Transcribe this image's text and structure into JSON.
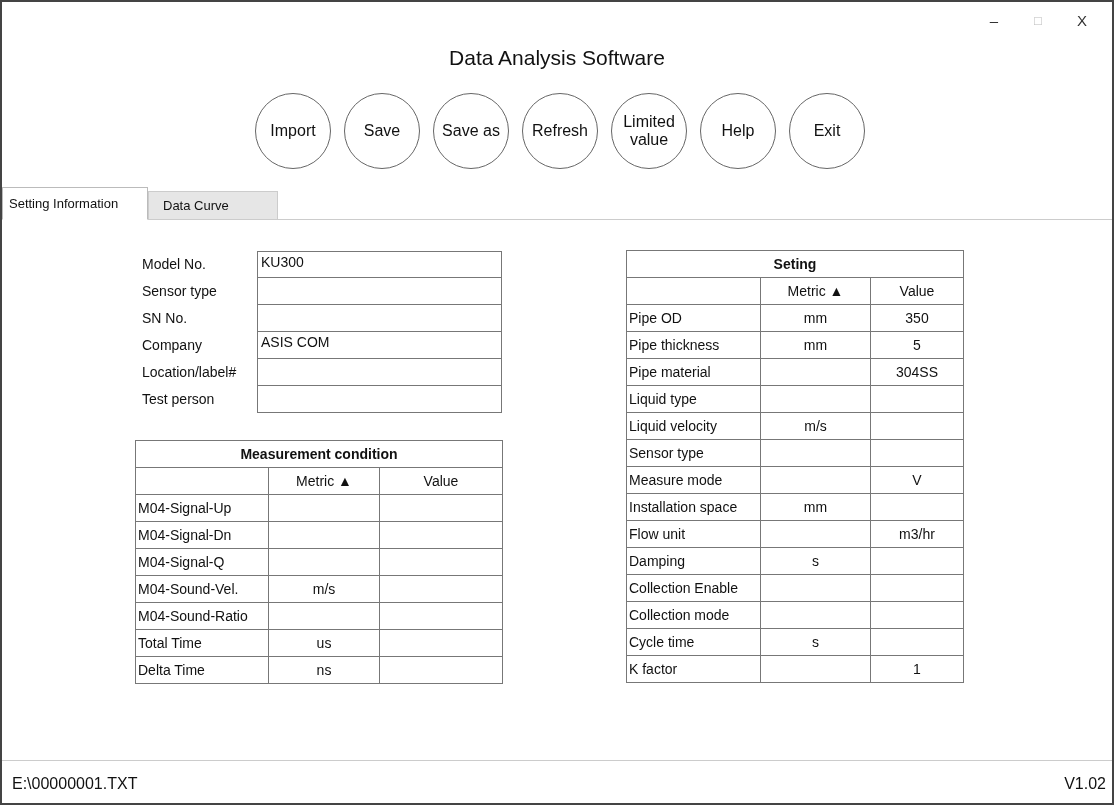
{
  "window": {
    "title": "Data Analysis Software",
    "controls": [
      {
        "kind": "minimize",
        "glyph": "–"
      },
      {
        "kind": "maximize",
        "glyph": "□"
      },
      {
        "kind": "close",
        "glyph": "X"
      }
    ]
  },
  "toolbar": [
    "Import",
    "Save",
    "Save as",
    "Refresh",
    "Limited value",
    "Help",
    "Exit"
  ],
  "tabs": [
    {
      "label": "Setting Information",
      "selected": true
    },
    {
      "label": "Data Curve",
      "selected": false
    }
  ],
  "info_form": [
    {
      "label": "Model No.",
      "value": "KU300"
    },
    {
      "label": "Sensor type"
    },
    {
      "label": "SN No."
    },
    {
      "label": "Company",
      "value": "ASIS COM"
    },
    {
      "label": "Location/label#"
    },
    {
      "label": "Test person"
    }
  ],
  "measurement_table": {
    "title": "Measurement condition",
    "columns": [
      "",
      "Metric ▲",
      "Value"
    ],
    "rows": [
      [
        "M04-Signal-Up",
        "",
        ""
      ],
      [
        "M04-Signal-Dn",
        "",
        ""
      ],
      [
        "M04-Signal-Q",
        "",
        ""
      ],
      [
        "M04-Sound-Vel.",
        "m/s",
        ""
      ],
      [
        "M04-Sound-Ratio",
        "",
        ""
      ],
      [
        "Total Time",
        "us",
        ""
      ],
      [
        "Delta Time",
        "ns",
        ""
      ]
    ]
  },
  "setting_table": {
    "title": "Seting",
    "columns": [
      "",
      "Metric ▲",
      "Value"
    ],
    "rows": [
      [
        "Pipe OD",
        "mm",
        "350"
      ],
      [
        "Pipe thickness",
        "mm",
        "5"
      ],
      [
        "Pipe material",
        "",
        "304SS"
      ],
      [
        "Liquid type",
        "",
        ""
      ],
      [
        "Liquid velocity",
        "m/s",
        ""
      ],
      [
        "Sensor type",
        "",
        ""
      ],
      [
        "Measure mode",
        "",
        "V"
      ],
      [
        "Installation space",
        "mm",
        ""
      ],
      [
        "Flow unit",
        "",
        "m3/hr"
      ],
      [
        "Damping",
        "s",
        ""
      ],
      [
        "Collection Enable",
        "",
        ""
      ],
      [
        "Collection mode",
        "",
        ""
      ],
      [
        "Cycle time",
        "s",
        ""
      ],
      [
        "K factor",
        "",
        "1"
      ]
    ]
  },
  "status_bar": {
    "file": "E:\\00000001.TXT",
    "version": "V1.02"
  }
}
